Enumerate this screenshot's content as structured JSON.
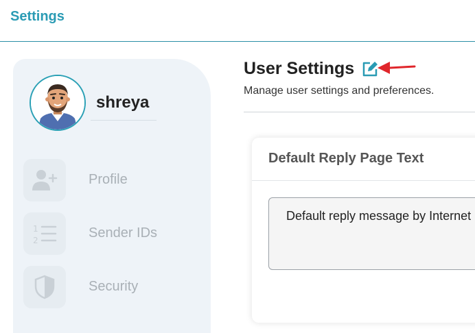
{
  "header": {
    "title": "Settings"
  },
  "user": {
    "name": "shreya"
  },
  "sidebar": {
    "items": [
      {
        "label": "Profile",
        "icon": "add-user-icon"
      },
      {
        "label": "Sender IDs",
        "icon": "numbered-list-icon"
      },
      {
        "label": "Security",
        "icon": "shield-icon"
      }
    ]
  },
  "main": {
    "title": "User Settings",
    "subtitle": "Manage user settings and preferences.",
    "card": {
      "title": "Default Reply Page Text",
      "message": "Default reply message by Internet"
    }
  },
  "colors": {
    "accent": "#2a9bb4",
    "arrow": "#e0262b",
    "sidebar_bg": "#eef3f8"
  }
}
